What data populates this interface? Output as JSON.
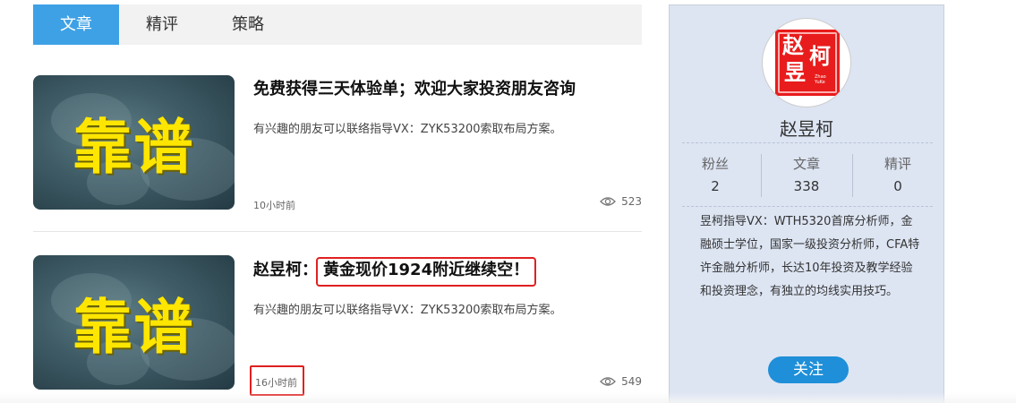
{
  "tabs": [
    {
      "label": "文章",
      "active": true
    },
    {
      "label": "精评",
      "active": false
    },
    {
      "label": "策略",
      "active": false
    }
  ],
  "articles": [
    {
      "thumb_text": "靠谱",
      "title": "免费获得三天体验单；欢迎大家投资朋友咨询",
      "excerpt": "有兴趣的朋友可以联络指导VX：ZYK53200索取布局方案。",
      "time": "10小时前",
      "views": "523"
    },
    {
      "thumb_text": "靠谱",
      "title_prefix": "赵昱柯：",
      "title_highlight": "黄金现价1924附近继续空！",
      "excerpt": "有兴趣的朋友可以联络指导VX：ZYK53200索取布局方案。",
      "time": "16小时前",
      "views": "549"
    }
  ],
  "profile": {
    "seal_chars": [
      "赵",
      "柯",
      "昱"
    ],
    "seal_small": "Zhao YuKe",
    "name": "赵昱柯",
    "stats": [
      {
        "label": "粉丝",
        "value": "2"
      },
      {
        "label": "文章",
        "value": "338"
      },
      {
        "label": "精评",
        "value": "0"
      }
    ],
    "bio": "昱柯指导VX：WTH5320首席分析师，金融硕士学位，国家一级投资分析师，CFA特许金融分析师，长达10年投资及教学经验和投资理念，有独立的均线实用技巧。",
    "follow_label": "关注"
  },
  "colors": {
    "accent": "#3ea1e6",
    "follow_button": "#1e8fd8",
    "highlight_border": "#e02020",
    "seal_red": "#e81c1c",
    "thumb_text": "#ffe600",
    "profile_bg": "#dde5f3"
  }
}
